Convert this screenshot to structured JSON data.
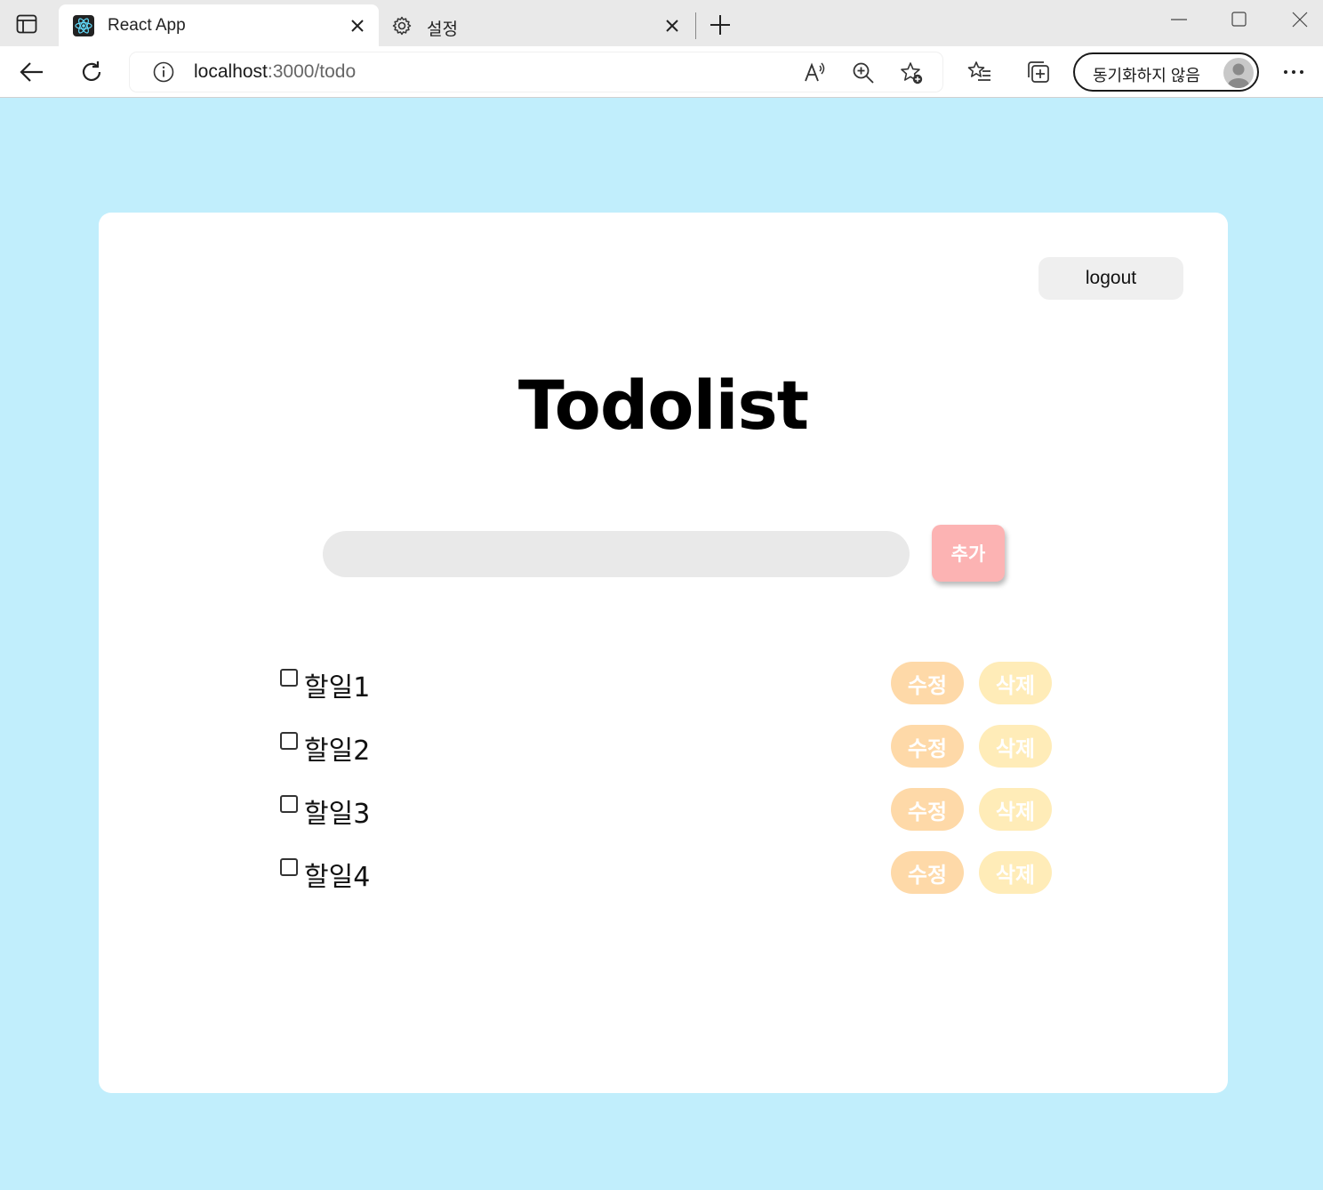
{
  "browser": {
    "active_tab_title": "React App",
    "inactive_tab_title": "설정",
    "url_host": "localhost",
    "url_rest": ":3000/todo",
    "profile_label": "동기화하지 않음"
  },
  "page": {
    "background": "#c1eefc",
    "logout_label": "logout",
    "title": "Todolist",
    "input_value": "",
    "add_label": "추가",
    "edit_label": "수정",
    "delete_label": "삭제",
    "todos": [
      {
        "text": "할일1",
        "checked": false
      },
      {
        "text": "할일2",
        "checked": false
      },
      {
        "text": "할일3",
        "checked": false
      },
      {
        "text": "할일4",
        "checked": false
      }
    ],
    "colors": {
      "add_button": "#fcb3b3",
      "edit_button": "#fed9a8",
      "delete_button": "#ffecb8",
      "input_bg": "#e9e9e9",
      "logout_bg": "#efefef"
    }
  }
}
